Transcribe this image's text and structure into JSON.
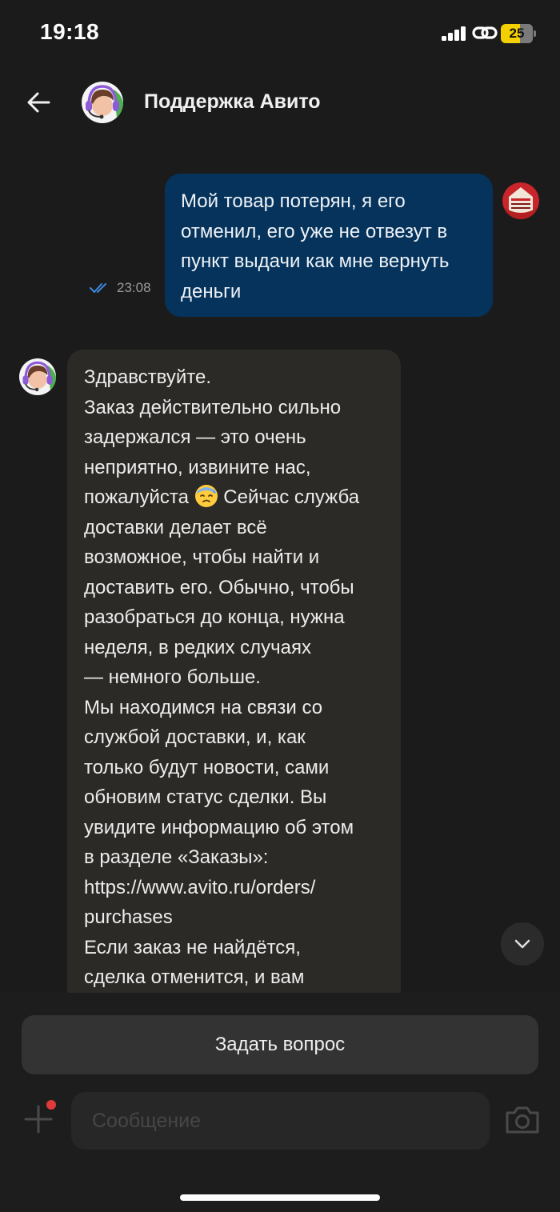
{
  "status_bar": {
    "time": "19:18",
    "battery_level": "25",
    "battery_color": "#f5d000",
    "icons": [
      "signal-icon",
      "link-icon",
      "battery-icon"
    ]
  },
  "header": {
    "title": "Поддержка Авито",
    "back_icon": "arrow-left-icon",
    "avatar": "support-agent-avatar"
  },
  "messages": [
    {
      "direction": "outgoing",
      "text": "Мой товар потерян, я его\nотменил, его уже не отвезут в\nпункт выдачи как мне вернуть\nденьги",
      "time": "23:08",
      "status_icon": "double-check-icon",
      "bubble_color": "#05335c"
    },
    {
      "direction": "incoming",
      "text_before_emoji": "Здравствуйте.\nЗаказ действительно сильно\nзадержался — это очень\nнеприятно, извините нас,\nпожалуйста ",
      "emoji": "downcast-face-with-sweat-emoji",
      "text_after_emoji": " Сейчас служба\nдоставки делает всё\nвозможное, чтобы найти и\nдоставить его. Обычно, чтобы\nразобраться до конца, нужна\nнеделя, в редких случаях\n— немного больше.\nМы находимся на связи со\nслужбой доставки, и, как\nтолько будут новости, сами\nобновим статус сделки. Вы\nувидите информацию об этом\nв разделе «Заказы»:\nhttps://www.avito.ru/orders/\npurchases\nЕсли заказ не найдётся,\nсделка отменится, и вам",
      "bubble_color": "#2c2a26"
    }
  ],
  "controls": {
    "ask_button_label": "Задать вопрос",
    "input_placeholder": "Сообщение",
    "input_value": "",
    "scroll_down_icon": "chevron-down-icon",
    "attach_icon": "plus-icon",
    "camera_icon": "camera-icon"
  },
  "colors": {
    "background": "#1b1b1b",
    "outgoing_bubble": "#05335c",
    "incoming_bubble": "#2c2a26",
    "check_marks": "#3d8ae0"
  }
}
